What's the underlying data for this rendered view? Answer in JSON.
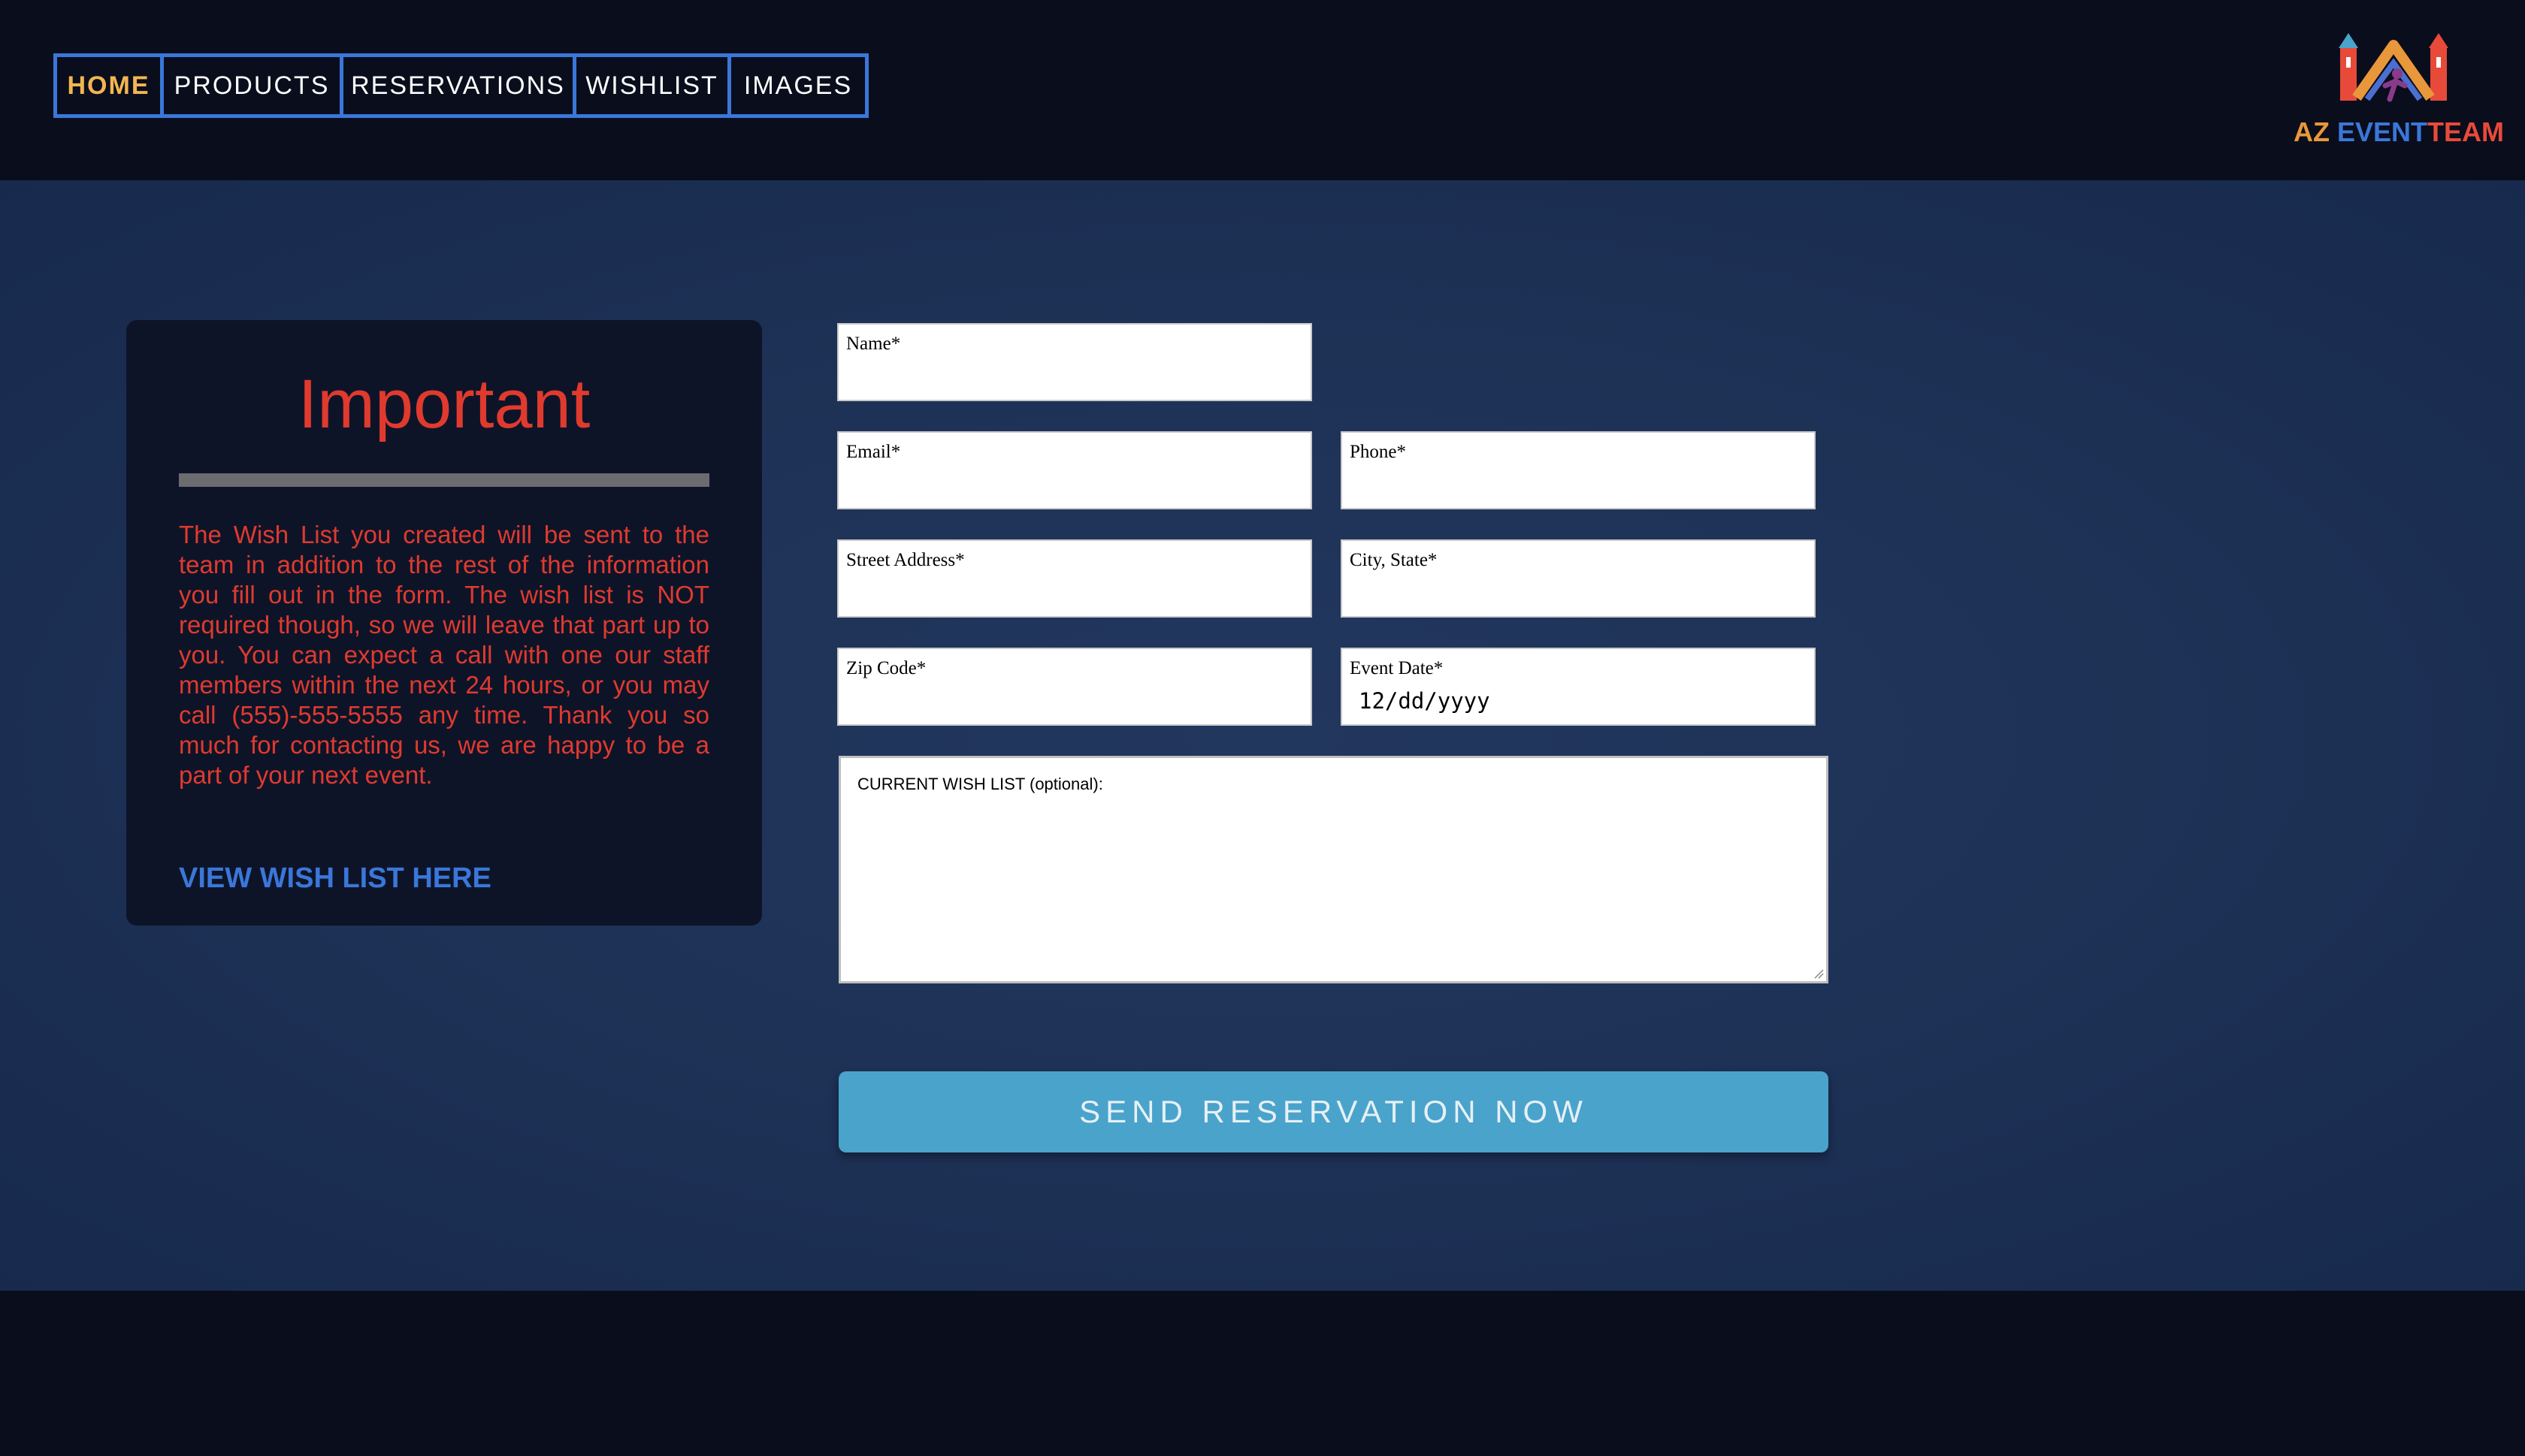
{
  "nav": {
    "items": [
      {
        "label": "HOME",
        "active": true
      },
      {
        "label": "PRODUCTS"
      },
      {
        "label": "RESERVATIONS"
      },
      {
        "label": "WISHLIST"
      },
      {
        "label": "IMAGES"
      }
    ],
    "accent_color": "#3a77d9",
    "active_color": "#f2b650"
  },
  "logo": {
    "part1": "AZ",
    "part2": "EVENT",
    "part3": "TEAM",
    "icon": "bounce-house-logo-icon"
  },
  "info": {
    "title": "Important",
    "text": "The Wish List you created will be sent to the team in addition to the rest of the information you fill out in the form. The wish list is NOT required though, so we will leave that part up to you. You can expect a call with one our staff members within the next 24 hours, or you may call (555)-555-5555 any time. Thank you so much for contacting us, we are happy to be a part of your next event.",
    "link": "VIEW WISH LIST HERE",
    "title_color": "#e03a2f"
  },
  "form": {
    "name_label": "Name*",
    "email_label": "Email*",
    "phone_label": "Phone*",
    "street_label": "Street Address*",
    "city_label": "City, State*",
    "zip_label": "Zip Code*",
    "date_label": "Event Date*",
    "date_value": "12/dd/yyyy",
    "wishlist_label": "CURRENT WISH LIST (optional):",
    "submit_label": "SEND RESERVATION NOW",
    "submit_color": "#4aa3cb"
  }
}
